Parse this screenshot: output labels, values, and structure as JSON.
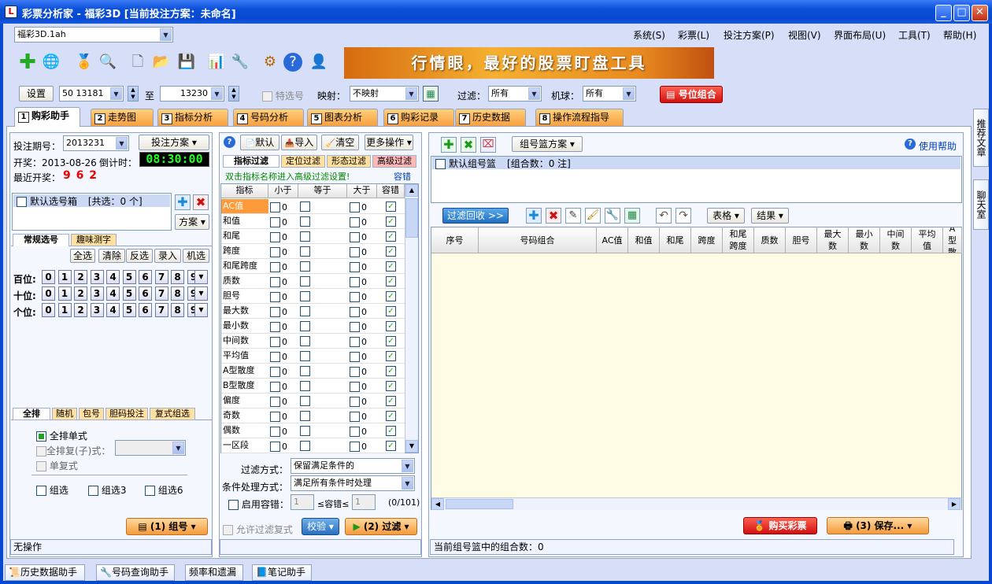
{
  "window": {
    "title": "彩票分析家 - 福彩3D [当前投注方案：未命名]"
  },
  "file_combo": "福彩3D.1ah",
  "menu": [
    "系统(S)",
    "彩票(L)",
    "投注方案(P)",
    "视图(V)",
    "界面布局(U)",
    "工具(T)",
    "帮助(H)"
  ],
  "banner": "行情眼，最好的股票盯盘工具",
  "toolbar2": {
    "setup": "设置",
    "from_period": "50 13181",
    "to_label": "至",
    "to_period": "13230",
    "special_label": "特选号",
    "map_label": "映射：",
    "map_value": "不映射",
    "filter_label": "过滤：",
    "filter_value": "所有",
    "machine_label": "机球：",
    "machine_value": "所有",
    "pos_combo": "号位组合"
  },
  "tabs": [
    {
      "n": "1",
      "label": "购彩助手"
    },
    {
      "n": "2",
      "label": "走势图"
    },
    {
      "n": "3",
      "label": "指标分析"
    },
    {
      "n": "4",
      "label": "号码分析"
    },
    {
      "n": "5",
      "label": "图表分析"
    },
    {
      "n": "6",
      "label": "购彩记录"
    },
    {
      "n": "7",
      "label": "历史数据"
    },
    {
      "n": "8",
      "label": "操作流程指导"
    }
  ],
  "left": {
    "period_label": "投注期号：",
    "period_value": "2013231",
    "plan_btn": "投注方案",
    "open_date": "开奖：2013-08-26",
    "countdown_label": "倒计时：",
    "countdown": "08:30:00",
    "recent_label": "最近开奖：",
    "recent_value": "9 6 2",
    "default_box": "默认选号箱",
    "box_count": "[共选：0 个]",
    "scheme_btn": "方案",
    "subtabs": [
      "常规选号",
      "趣味测字"
    ],
    "actions": [
      "全选",
      "清除",
      "反选",
      "录入",
      "机选"
    ],
    "rows": [
      "百位:",
      "十位:",
      "个位:"
    ],
    "digits": [
      "0",
      "1",
      "2",
      "3",
      "4",
      "5",
      "6",
      "7",
      "8",
      "9"
    ],
    "bottom_tabs": [
      "全排",
      "随机",
      "包号",
      "胆码投注",
      "复式组选"
    ],
    "options": [
      "全排单式",
      "全排复(子)式：",
      "单复式"
    ],
    "group_opts": [
      "组选",
      "组选3",
      "组选6"
    ],
    "group_btn": "(1) 组号",
    "status": "无操作"
  },
  "middle": {
    "toolbar": [
      "默认",
      "导入",
      "清空",
      "更多操作"
    ],
    "tabs": [
      "指标过滤",
      "定位过滤",
      "形态过滤",
      "高级过滤"
    ],
    "hint": "双击指标名称进入高级过滤设置!",
    "tolerance_link": "容错",
    "cols": [
      "指标",
      "小于",
      "等于",
      "大于",
      "容错"
    ],
    "rows": [
      "AC值",
      "和值",
      "和尾",
      "跨度",
      "和尾跨度",
      "质数",
      "胆号",
      "最大数",
      "最小数",
      "中间数",
      "平均值",
      "A型散度",
      "B型散度",
      "偏度",
      "奇数",
      "偶数",
      "一区段"
    ],
    "zero": "0",
    "filter_mode_label": "过滤方式：",
    "filter_mode": "保留满足条件的",
    "cond_label": "条件处理方式：",
    "cond_value": "满足所有条件时处理",
    "enable_tol": "启用容错：",
    "tol_a": "1",
    "tol_mid": "≤容错≤",
    "tol_b": "1",
    "tol_count": "(0/101)",
    "allow_dup": "允许过滤复式",
    "verify_btn": "校验",
    "filter_btn": "(2) 过滤"
  },
  "right": {
    "plan_btn": "组号篮方案",
    "help_link": "使用帮助",
    "basket": "默认组号篮",
    "basket_count": "[组合数：0 注]",
    "recycle_btn": "过滤回收 >>",
    "table_btn": "表格",
    "result_btn": "结果",
    "cols": [
      "序号",
      "号码组合",
      "AC值",
      "和值",
      "和尾",
      "跨度",
      "和尾跨度",
      "质数",
      "胆号",
      "最大数",
      "最小数",
      "中间数",
      "平均值",
      "A型散"
    ],
    "buy_btn": "购买彩票",
    "save_btn": "(3) 保存...",
    "status": "当前组号篮中的组合数：0"
  },
  "side": [
    "推荐文章",
    "聊天室"
  ],
  "statusbar": [
    "历史数据助手",
    "号码查询助手",
    "频率和遗漏",
    "笔记助手"
  ]
}
